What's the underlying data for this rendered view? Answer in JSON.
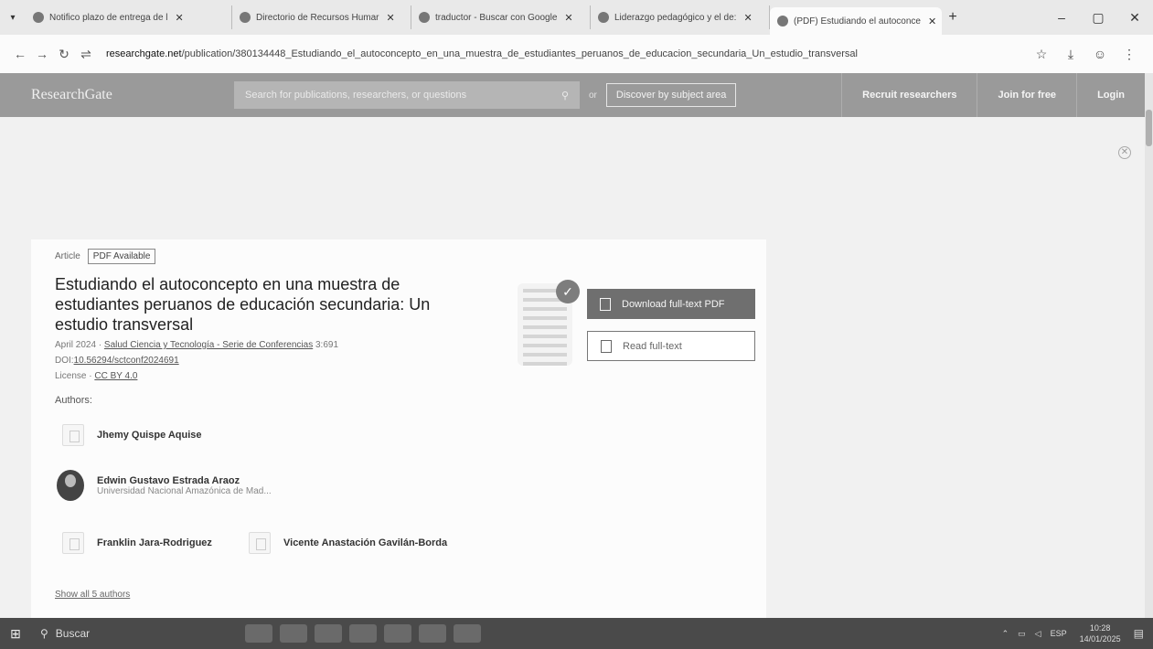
{
  "browser": {
    "tabs": [
      {
        "label": "Notifico plazo de entrega de l"
      },
      {
        "label": "Directorio de Recursos Humar"
      },
      {
        "label": "traductor - Buscar con Google"
      },
      {
        "label": "Liderazgo pedagógico y el de:"
      },
      {
        "label": "(PDF) Estudiando el autoconce"
      }
    ],
    "url_domain": "researchgate.net",
    "url_path": "/publication/380134448_Estudiando_el_autoconcepto_en_una_muestra_de_estudiantes_peruanos_de_educacion_secundaria_Un_estudio_transversal"
  },
  "rg": {
    "logo": "ResearchGate",
    "search_placeholder": "Search for publications, researchers, or questions",
    "or": "or",
    "discover": "Discover by subject area",
    "recruit": "Recruit researchers",
    "join": "Join for free",
    "login": "Login"
  },
  "article": {
    "type": "Article",
    "pdf_badge": "PDF Available",
    "title": "Estudiando el autoconcepto en una muestra de estudiantes peruanos de educación secundaria: Un estudio transversal",
    "date": "April 2024 · ",
    "journal": "Salud Ciencia y Tecnología - Serie de Conferencias",
    "volume": " 3:691",
    "doi_label": "DOI:",
    "doi": "10.56294/sctconf2024691",
    "license_label": "License · ",
    "license": "CC BY 4.0",
    "authors_label": "Authors:",
    "authors": [
      {
        "name": "Jhemy Quispe Aquise",
        "affiliation": ""
      },
      {
        "name": "Edwin Gustavo Estrada Araoz",
        "affiliation": "Universidad Nacional Amazónica de Mad..."
      },
      {
        "name": "Franklin Jara-Rodriguez",
        "affiliation": ""
      },
      {
        "name": "Vicente Anastación Gavilán-Borda",
        "affiliation": ""
      }
    ],
    "show_all": "Show all 5 authors",
    "download": "Download full-text PDF",
    "read": "Read full-text"
  },
  "taskbar": {
    "search": "Buscar",
    "lang": "ESP",
    "time": "10:28",
    "date": "14/01/2025"
  }
}
